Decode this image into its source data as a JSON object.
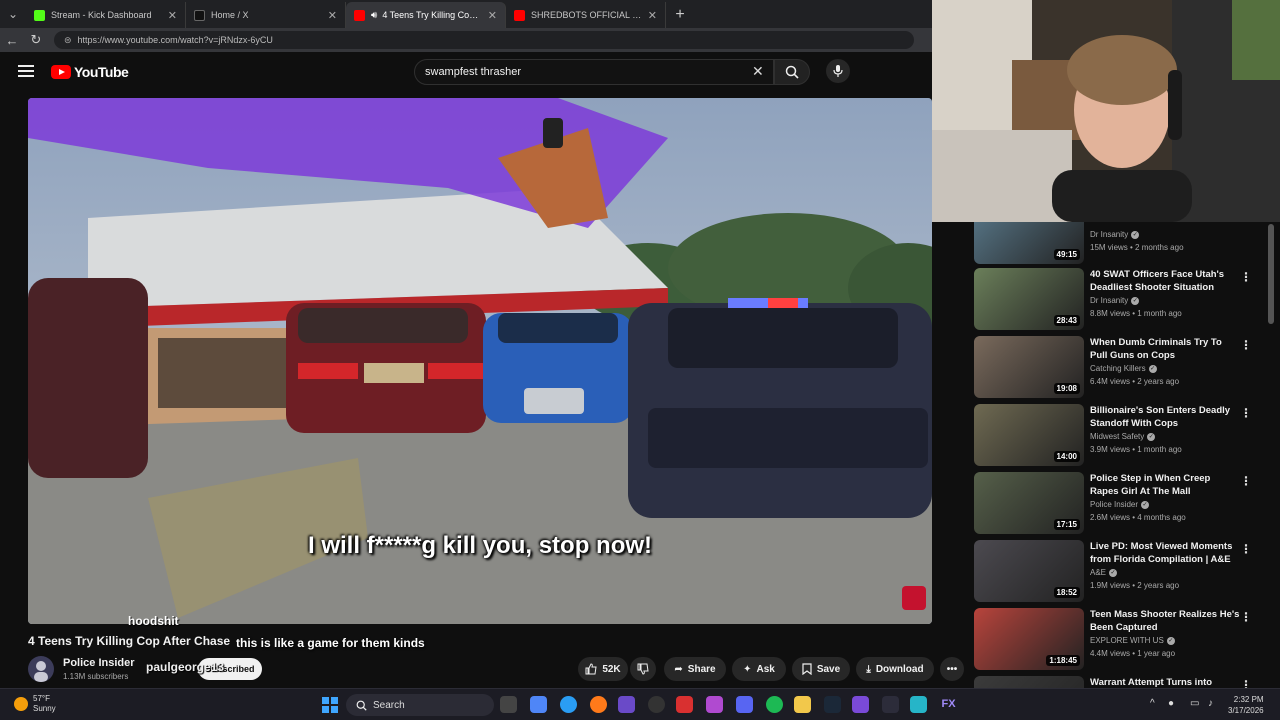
{
  "browser": {
    "tabs": [
      {
        "label": "Stream - Kick Dashboard",
        "color": "#53fc18",
        "active": false
      },
      {
        "label": "Home / X",
        "color": "#444444",
        "active": false
      },
      {
        "label": "4 Teens Try Killing Cop After C",
        "color": "#ff0000",
        "active": true
      },
      {
        "label": "SHREDBOTS OFFICIAL - YouTube",
        "color": "#ff0000",
        "active": false
      }
    ],
    "url": "https://www.youtube.com/watch?v=jRNdzx-6yCU"
  },
  "youtube": {
    "logo_text": "YouTube",
    "search_value": "swampfest thrasher"
  },
  "video": {
    "subtitle": "I will f*****g kill you, stop now!",
    "title": "4 Teens Try Killing Cop After Chase",
    "channel_name": "Police Insider",
    "channel_subs": "1.13M subscribers",
    "subscribe_label": "Subscribed",
    "likes": "52K",
    "share_label": "Share",
    "ask_label": "Ask",
    "save_label": "Save",
    "download_label": "Download"
  },
  "chat_overlay": {
    "user1": "hoodshit",
    "message": "this is like a game for them kinds",
    "user2": "paulgeorge13"
  },
  "recommendations": [
    {
      "title": "",
      "channel": "Dr Insanity",
      "meta": "15M views • 2 months ago",
      "duration": "49:15",
      "thumb": "#5a7a8c"
    },
    {
      "title": "40 SWAT Officers Face Utah's Deadliest Shooter Situation",
      "channel": "Dr Insanity",
      "meta": "8.8M views • 1 month ago",
      "duration": "28:43",
      "thumb": "#6b7f5a"
    },
    {
      "title": "When Dumb Criminals Try To Pull Guns on Cops",
      "channel": "Catching Killers",
      "meta": "6.4M views • 2 years ago",
      "duration": "19:08",
      "thumb": "#7a6a5c"
    },
    {
      "title": "Billionaire's Son Enters Deadly Standoff With Cops",
      "channel": "Midwest Safety",
      "meta": "3.9M views • 1 month ago",
      "duration": "14:00",
      "thumb": "#6f6a52"
    },
    {
      "title": "Police Step in When Creep Rapes Girl At The Mall",
      "channel": "Police Insider",
      "meta": "2.6M views • 4 months ago",
      "duration": "17:15",
      "thumb": "#56604a"
    },
    {
      "title": "Live PD: Most Viewed Moments from Florida Compilation | A&E",
      "channel": "A&E",
      "meta": "1.9M views • 2 years ago",
      "duration": "18:52",
      "thumb": "#4c4a50"
    },
    {
      "title": "Teen Mass Shooter Realizes He's Been Captured",
      "channel": "EXPLORE WITH US",
      "meta": "4.4M views • 1 year ago",
      "duration": "1:18:45",
      "thumb": "#b8443c"
    },
    {
      "title": "Warrant Attempt Turns into",
      "channel": "",
      "meta": "",
      "duration": "",
      "thumb": "#3b3b3b"
    }
  ],
  "taskbar": {
    "temp": "57°F",
    "condition": "Sunny",
    "search_label": "Search",
    "time": "2:32 PM",
    "date": "3/17/2026"
  }
}
